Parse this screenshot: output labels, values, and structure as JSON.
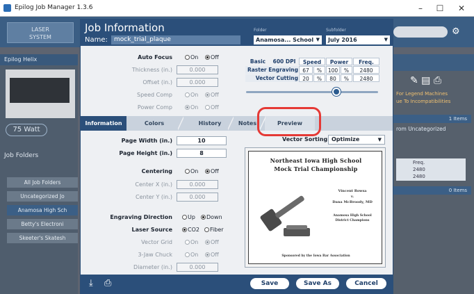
{
  "window": {
    "title": "Epilog Job Manager 1.3.6",
    "minimize": "–",
    "maximize": "☐",
    "close": "✕"
  },
  "background": {
    "laser_system": "LASER\nSYSTEM",
    "machine_panel_title": "Epilog Helix",
    "wattage": "75 Watt",
    "job_folders_title": "Job Folders",
    "folders": [
      "All Job Folders",
      "Uncategorized Jo",
      "Anamosa High Sch",
      "Betty's Electroni",
      "Skeeter's Skatesh"
    ],
    "right_note": "For Legend Machines\nue To Incompatibilities",
    "right_count1": "1 Items",
    "right_uncat": "rom Uncategorized",
    "right_table_header": "Freq.",
    "right_table_values": [
      "2480",
      "2480"
    ],
    "right_count2": "0 Items"
  },
  "dialog": {
    "title": "Job Information",
    "name_label": "Name:",
    "name_value": "mock_trial_plaque",
    "folder_label": "Folder",
    "folder_value": "Anamosa... School",
    "subfolder_label": "Subfolder",
    "subfolder_value": "July 2016",
    "auto_focus": {
      "label": "Auto Focus",
      "on": "On",
      "off": "Off",
      "selected": "off"
    },
    "thickness": {
      "label": "Thickness (in.)",
      "value": "0.000"
    },
    "offset": {
      "label": "Offset (in.)",
      "value": "0.000"
    },
    "speed_comp": {
      "label": "Speed Comp",
      "on": "On",
      "off": "Off",
      "selected": "off"
    },
    "power_comp": {
      "label": "Power Comp",
      "on": "On",
      "off": "Off",
      "selected": "on"
    },
    "params": {
      "mode": "Basic",
      "dpi": "600 DPI",
      "headers": [
        "Speed",
        "Power",
        "Freq."
      ],
      "rows": [
        {
          "label": "Raster Engraving",
          "speed": "67",
          "power": "100",
          "freq": "2480"
        },
        {
          "label": "Vector Cutting",
          "speed": "20",
          "power": "80",
          "freq": "2480"
        }
      ],
      "pct": "%"
    },
    "tabs": [
      "Information",
      "Colors",
      "History",
      "Notes",
      "Preview"
    ],
    "page_width": {
      "label": "Page Width (in.)",
      "value": "10"
    },
    "page_height": {
      "label": "Page Height (in.)",
      "value": "8"
    },
    "centering": {
      "label": "Centering",
      "on": "On",
      "off": "Off",
      "selected": "off"
    },
    "center_x": {
      "label": "Center X (in.)",
      "value": "0.000"
    },
    "center_y": {
      "label": "Center Y (in.)",
      "value": "0.000"
    },
    "engraving_direction": {
      "label": "Engraving Direction",
      "up": "Up",
      "down": "Down",
      "selected": "down"
    },
    "laser_source": {
      "label": "Laser Source",
      "co2": "CO2",
      "fiber": "Fiber",
      "selected": "co2"
    },
    "vector_grid": {
      "label": "Vector Grid",
      "on": "On",
      "off": "Off",
      "selected": "off"
    },
    "three_jaw": {
      "label": "3-Jaw Chuck",
      "on": "On",
      "off": "Off",
      "selected": "off"
    },
    "diameter": {
      "label": "Diameter (in.)",
      "value": "0.000"
    },
    "vector_sorting": {
      "label": "Vector Sorting",
      "value": "Optimize"
    },
    "preview": {
      "line1": "Northeast Iowa High School",
      "line2": "Mock Trial Championship",
      "name1": "Vincent Rowsa",
      "vs": "v.",
      "name2": "Dana McBroody, MD",
      "school1": "Anamosa High School",
      "school2": "District Champions",
      "sponsor": "Sponsored by the Iowa Bar Association"
    },
    "buttons": {
      "save": "Save",
      "save_as": "Save As",
      "cancel": "Cancel"
    }
  },
  "colors": {
    "accent": "#2b4f7a",
    "highlight": "#e53935"
  }
}
